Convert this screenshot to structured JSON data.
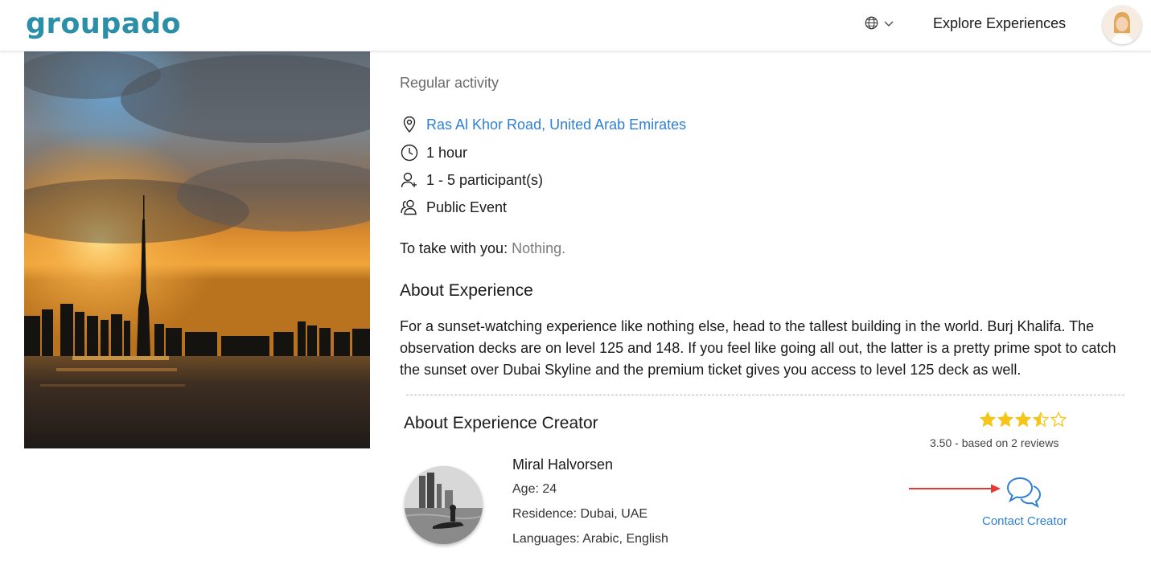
{
  "header": {
    "logo_text": "groupado",
    "logo_color": "#2b8fa8",
    "nav_explore": "Explore Experiences",
    "icons": {
      "language": "globe-icon",
      "dropdown": "chevron-down-icon",
      "profile": "user-avatar"
    }
  },
  "experience": {
    "activity_type": "Regular activity",
    "location": "Ras Al Khor Road, United Arab Emirates",
    "duration": "1 hour",
    "participants": "1 - 5 participant(s)",
    "event_type": "Public Event",
    "take_with_label": "To take with you:",
    "take_with_value": "Nothing.",
    "about_heading": "About Experience",
    "about_text": "For a sunset-watching experience like nothing else, head to the tallest building in the world. Burj Khalifa. The observation decks are on level 125 and 148. If you feel like going all out, the latter is a pretty prime spot to catch the sunset over Dubai Skyline and the premium ticket gives you access to level 125 deck as well."
  },
  "creator": {
    "heading": "About Experience Creator",
    "rating_value": 3.5,
    "rating_max": 5,
    "rating_text": "3.50 - based on 2 reviews",
    "name": "Miral Halvorsen",
    "age_label": "Age:",
    "age_value": "24",
    "residence_label": "Residence:",
    "residence_value": "Dubai, UAE",
    "languages_label": "Languages:",
    "languages_value": "Arabic, English",
    "contact_label": "Contact Creator"
  },
  "colors": {
    "accent_blue": "#2f80d4",
    "star": "#f5c518",
    "annotation_arrow": "#e53935"
  }
}
